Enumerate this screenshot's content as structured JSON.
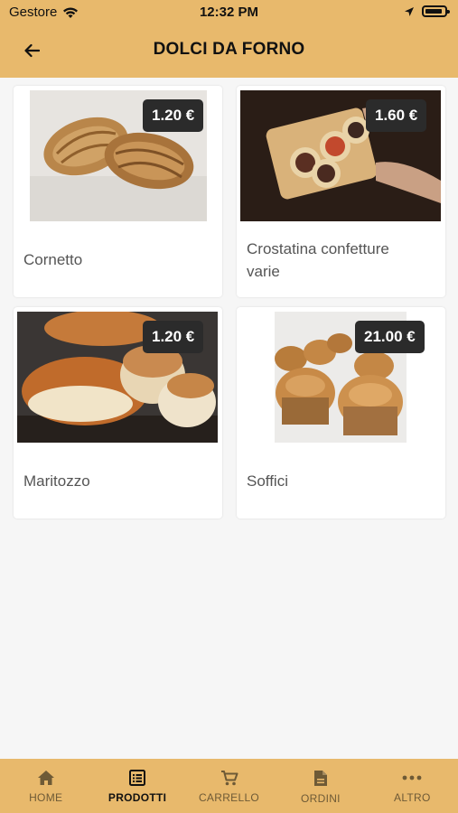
{
  "status_bar": {
    "carrier": "Gestore",
    "time": "12:32 PM",
    "icons": [
      "wifi-icon",
      "location-arrow-icon",
      "battery-icon"
    ]
  },
  "header": {
    "title": "DOLCI DA FORNO",
    "back_icon": "arrow-left-icon"
  },
  "products": [
    {
      "name": "Cornetto",
      "price": "1.20 €",
      "image": "croissants"
    },
    {
      "name": "Crostatina confetture varie",
      "price": "1.60 €",
      "image": "jam-tarts"
    },
    {
      "name": "Maritozzo",
      "price": "1.20 €",
      "image": "sweet-buns"
    },
    {
      "name": "Soffici",
      "price": "21.00 €",
      "image": "muffins"
    }
  ],
  "tabs": [
    {
      "label": "HOME",
      "icon": "home-icon",
      "active": false
    },
    {
      "label": "PRODOTTI",
      "icon": "list-icon",
      "active": true
    },
    {
      "label": "CARRELLO",
      "icon": "cart-icon",
      "active": false
    },
    {
      "label": "ORDINI",
      "icon": "document-icon",
      "active": false
    },
    {
      "label": "ALTRO",
      "icon": "more-icon",
      "active": false
    }
  ],
  "colors": {
    "brand": "#e8b96c",
    "price_badge": "#2b2b2b",
    "background": "#f6f6f6"
  }
}
